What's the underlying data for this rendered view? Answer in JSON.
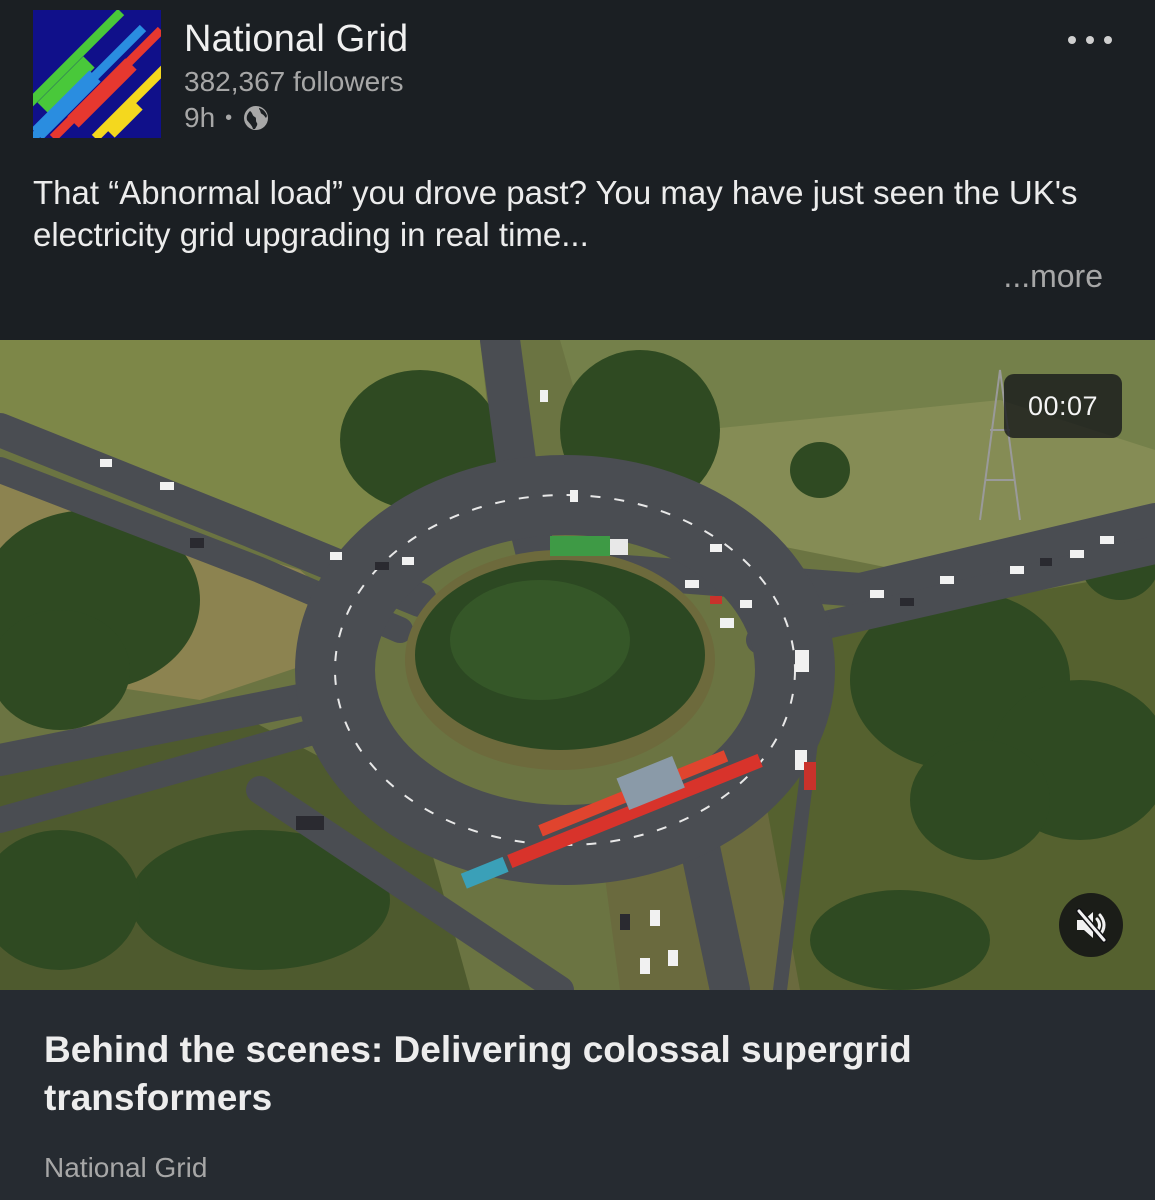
{
  "post": {
    "author": "National Grid",
    "followers": "382,367 followers",
    "time": "9h",
    "separator": "•",
    "text": "That “Abnormal load” you drove past? You may have just seen the UK's electricity grid upgrading in real time...",
    "see_more": "...more"
  },
  "video": {
    "duration": "00:07"
  },
  "link_card": {
    "title": "Behind the scenes: Delivering colossal supergrid transformers",
    "source": "National Grid"
  },
  "icons": {
    "menu": "more-options-icon",
    "visibility": "globe-icon",
    "mute": "speaker-muted-icon"
  },
  "colors": {
    "background": "#1b1f23",
    "card": "#262b31",
    "logo_blue": "#10108a"
  }
}
